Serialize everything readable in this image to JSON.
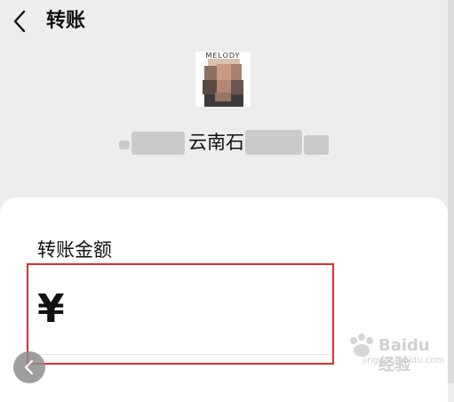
{
  "header": {
    "title": "转账"
  },
  "recipient": {
    "avatar_brand": "MELODY",
    "name_visible": "云南石"
  },
  "transfer": {
    "amount_label": "转账金额",
    "currency_symbol": "¥",
    "amount_value": ""
  },
  "watermark": {
    "text": "Baidu经验",
    "sub": "jingyan.baidu.com"
  },
  "colors": {
    "highlight_box": "#e52b2b",
    "background": "#ededed",
    "card": "#ffffff"
  }
}
